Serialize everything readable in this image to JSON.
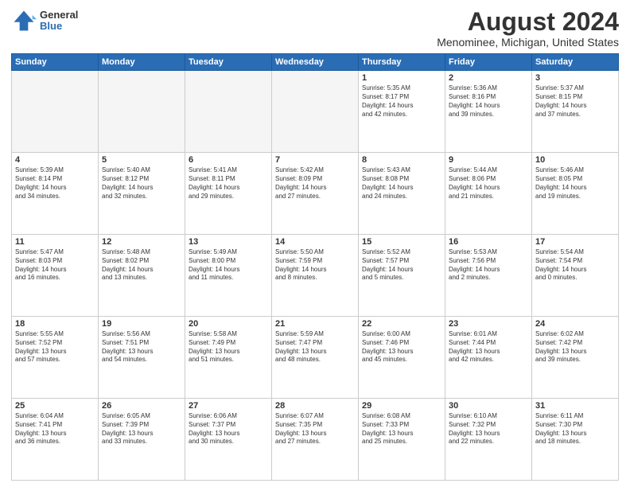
{
  "header": {
    "logo_general": "General",
    "logo_blue": "Blue",
    "title": "August 2024",
    "subtitle": "Menominee, Michigan, United States"
  },
  "days_of_week": [
    "Sunday",
    "Monday",
    "Tuesday",
    "Wednesday",
    "Thursday",
    "Friday",
    "Saturday"
  ],
  "weeks": [
    [
      {
        "day": "",
        "info": ""
      },
      {
        "day": "",
        "info": ""
      },
      {
        "day": "",
        "info": ""
      },
      {
        "day": "",
        "info": ""
      },
      {
        "day": "1",
        "info": "Sunrise: 5:35 AM\nSunset: 8:17 PM\nDaylight: 14 hours\nand 42 minutes."
      },
      {
        "day": "2",
        "info": "Sunrise: 5:36 AM\nSunset: 8:16 PM\nDaylight: 14 hours\nand 39 minutes."
      },
      {
        "day": "3",
        "info": "Sunrise: 5:37 AM\nSunset: 8:15 PM\nDaylight: 14 hours\nand 37 minutes."
      }
    ],
    [
      {
        "day": "4",
        "info": "Sunrise: 5:39 AM\nSunset: 8:14 PM\nDaylight: 14 hours\nand 34 minutes."
      },
      {
        "day": "5",
        "info": "Sunrise: 5:40 AM\nSunset: 8:12 PM\nDaylight: 14 hours\nand 32 minutes."
      },
      {
        "day": "6",
        "info": "Sunrise: 5:41 AM\nSunset: 8:11 PM\nDaylight: 14 hours\nand 29 minutes."
      },
      {
        "day": "7",
        "info": "Sunrise: 5:42 AM\nSunset: 8:09 PM\nDaylight: 14 hours\nand 27 minutes."
      },
      {
        "day": "8",
        "info": "Sunrise: 5:43 AM\nSunset: 8:08 PM\nDaylight: 14 hours\nand 24 minutes."
      },
      {
        "day": "9",
        "info": "Sunrise: 5:44 AM\nSunset: 8:06 PM\nDaylight: 14 hours\nand 21 minutes."
      },
      {
        "day": "10",
        "info": "Sunrise: 5:46 AM\nSunset: 8:05 PM\nDaylight: 14 hours\nand 19 minutes."
      }
    ],
    [
      {
        "day": "11",
        "info": "Sunrise: 5:47 AM\nSunset: 8:03 PM\nDaylight: 14 hours\nand 16 minutes."
      },
      {
        "day": "12",
        "info": "Sunrise: 5:48 AM\nSunset: 8:02 PM\nDaylight: 14 hours\nand 13 minutes."
      },
      {
        "day": "13",
        "info": "Sunrise: 5:49 AM\nSunset: 8:00 PM\nDaylight: 14 hours\nand 11 minutes."
      },
      {
        "day": "14",
        "info": "Sunrise: 5:50 AM\nSunset: 7:59 PM\nDaylight: 14 hours\nand 8 minutes."
      },
      {
        "day": "15",
        "info": "Sunrise: 5:52 AM\nSunset: 7:57 PM\nDaylight: 14 hours\nand 5 minutes."
      },
      {
        "day": "16",
        "info": "Sunrise: 5:53 AM\nSunset: 7:56 PM\nDaylight: 14 hours\nand 2 minutes."
      },
      {
        "day": "17",
        "info": "Sunrise: 5:54 AM\nSunset: 7:54 PM\nDaylight: 14 hours\nand 0 minutes."
      }
    ],
    [
      {
        "day": "18",
        "info": "Sunrise: 5:55 AM\nSunset: 7:52 PM\nDaylight: 13 hours\nand 57 minutes."
      },
      {
        "day": "19",
        "info": "Sunrise: 5:56 AM\nSunset: 7:51 PM\nDaylight: 13 hours\nand 54 minutes."
      },
      {
        "day": "20",
        "info": "Sunrise: 5:58 AM\nSunset: 7:49 PM\nDaylight: 13 hours\nand 51 minutes."
      },
      {
        "day": "21",
        "info": "Sunrise: 5:59 AM\nSunset: 7:47 PM\nDaylight: 13 hours\nand 48 minutes."
      },
      {
        "day": "22",
        "info": "Sunrise: 6:00 AM\nSunset: 7:46 PM\nDaylight: 13 hours\nand 45 minutes."
      },
      {
        "day": "23",
        "info": "Sunrise: 6:01 AM\nSunset: 7:44 PM\nDaylight: 13 hours\nand 42 minutes."
      },
      {
        "day": "24",
        "info": "Sunrise: 6:02 AM\nSunset: 7:42 PM\nDaylight: 13 hours\nand 39 minutes."
      }
    ],
    [
      {
        "day": "25",
        "info": "Sunrise: 6:04 AM\nSunset: 7:41 PM\nDaylight: 13 hours\nand 36 minutes."
      },
      {
        "day": "26",
        "info": "Sunrise: 6:05 AM\nSunset: 7:39 PM\nDaylight: 13 hours\nand 33 minutes."
      },
      {
        "day": "27",
        "info": "Sunrise: 6:06 AM\nSunset: 7:37 PM\nDaylight: 13 hours\nand 30 minutes."
      },
      {
        "day": "28",
        "info": "Sunrise: 6:07 AM\nSunset: 7:35 PM\nDaylight: 13 hours\nand 27 minutes."
      },
      {
        "day": "29",
        "info": "Sunrise: 6:08 AM\nSunset: 7:33 PM\nDaylight: 13 hours\nand 25 minutes."
      },
      {
        "day": "30",
        "info": "Sunrise: 6:10 AM\nSunset: 7:32 PM\nDaylight: 13 hours\nand 22 minutes."
      },
      {
        "day": "31",
        "info": "Sunrise: 6:11 AM\nSunset: 7:30 PM\nDaylight: 13 hours\nand 18 minutes."
      }
    ]
  ]
}
